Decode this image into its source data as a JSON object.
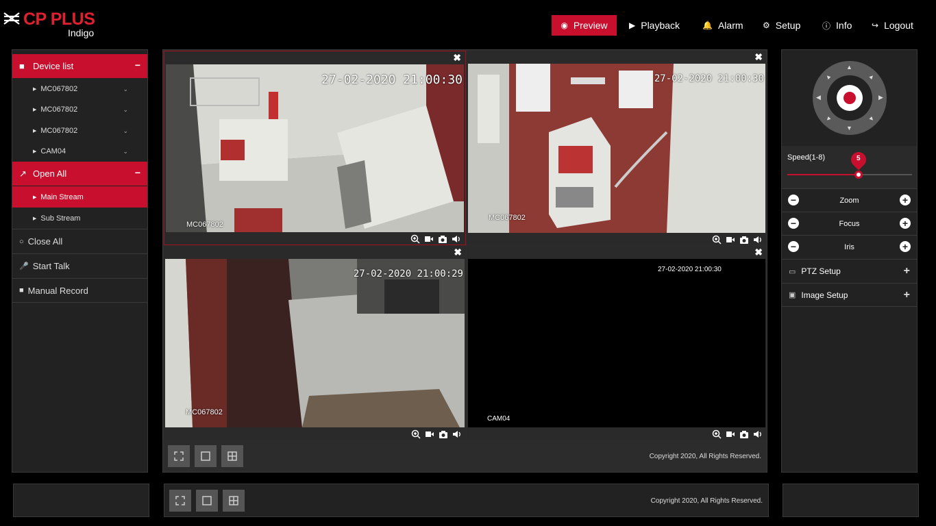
{
  "header": {
    "brand": "CP PLUS",
    "sub_brand": "Indigo",
    "nav": [
      {
        "label": "Preview"
      },
      {
        "label": "Playback"
      },
      {
        "label": "Alarm"
      },
      {
        "label": "Setup"
      },
      {
        "label": "Info"
      },
      {
        "label": "Logout"
      }
    ],
    "active_color": "#c8102e"
  },
  "left_panel": {
    "device_list_label": "Device list",
    "devices": [
      {
        "name": "MC067802"
      },
      {
        "name": "MC067802"
      },
      {
        "name": "MC067802"
      },
      {
        "name": "CAM04"
      }
    ],
    "open_all_label": "Open All",
    "main_stream_label": "Main Stream",
    "sub_stream_label": "Sub Stream",
    "close_all_label": "Close All",
    "start_talk_label": "Start Talk",
    "manual_record_label": "Manual Record"
  },
  "video": {
    "cells": [
      {
        "timestamp": "27-02-2020 21:00:30",
        "camera": "MC067802"
      },
      {
        "timestamp": "27-02-2020 21:00:30",
        "camera": "MC067802"
      },
      {
        "timestamp": "27-02-2020 21:00:29",
        "camera": "MC067802"
      },
      {
        "timestamp": "27-02-2020 21:00:30",
        "camera": "CAM04"
      }
    ],
    "copyright": "Copyright 2020, All Rights Reserved."
  },
  "bottom": {
    "copyright": "Copyright 2020, All Rights Reserved."
  },
  "ptz": {
    "speed_label": "Speed(1-8)",
    "speed_value": "5",
    "speed_fraction": 0.57,
    "zoom_label": "Zoom",
    "focus_label": "Focus",
    "iris_label": "Iris",
    "ptz_setup_label": "PTZ Setup",
    "image_setup_label": "Image Setup"
  }
}
